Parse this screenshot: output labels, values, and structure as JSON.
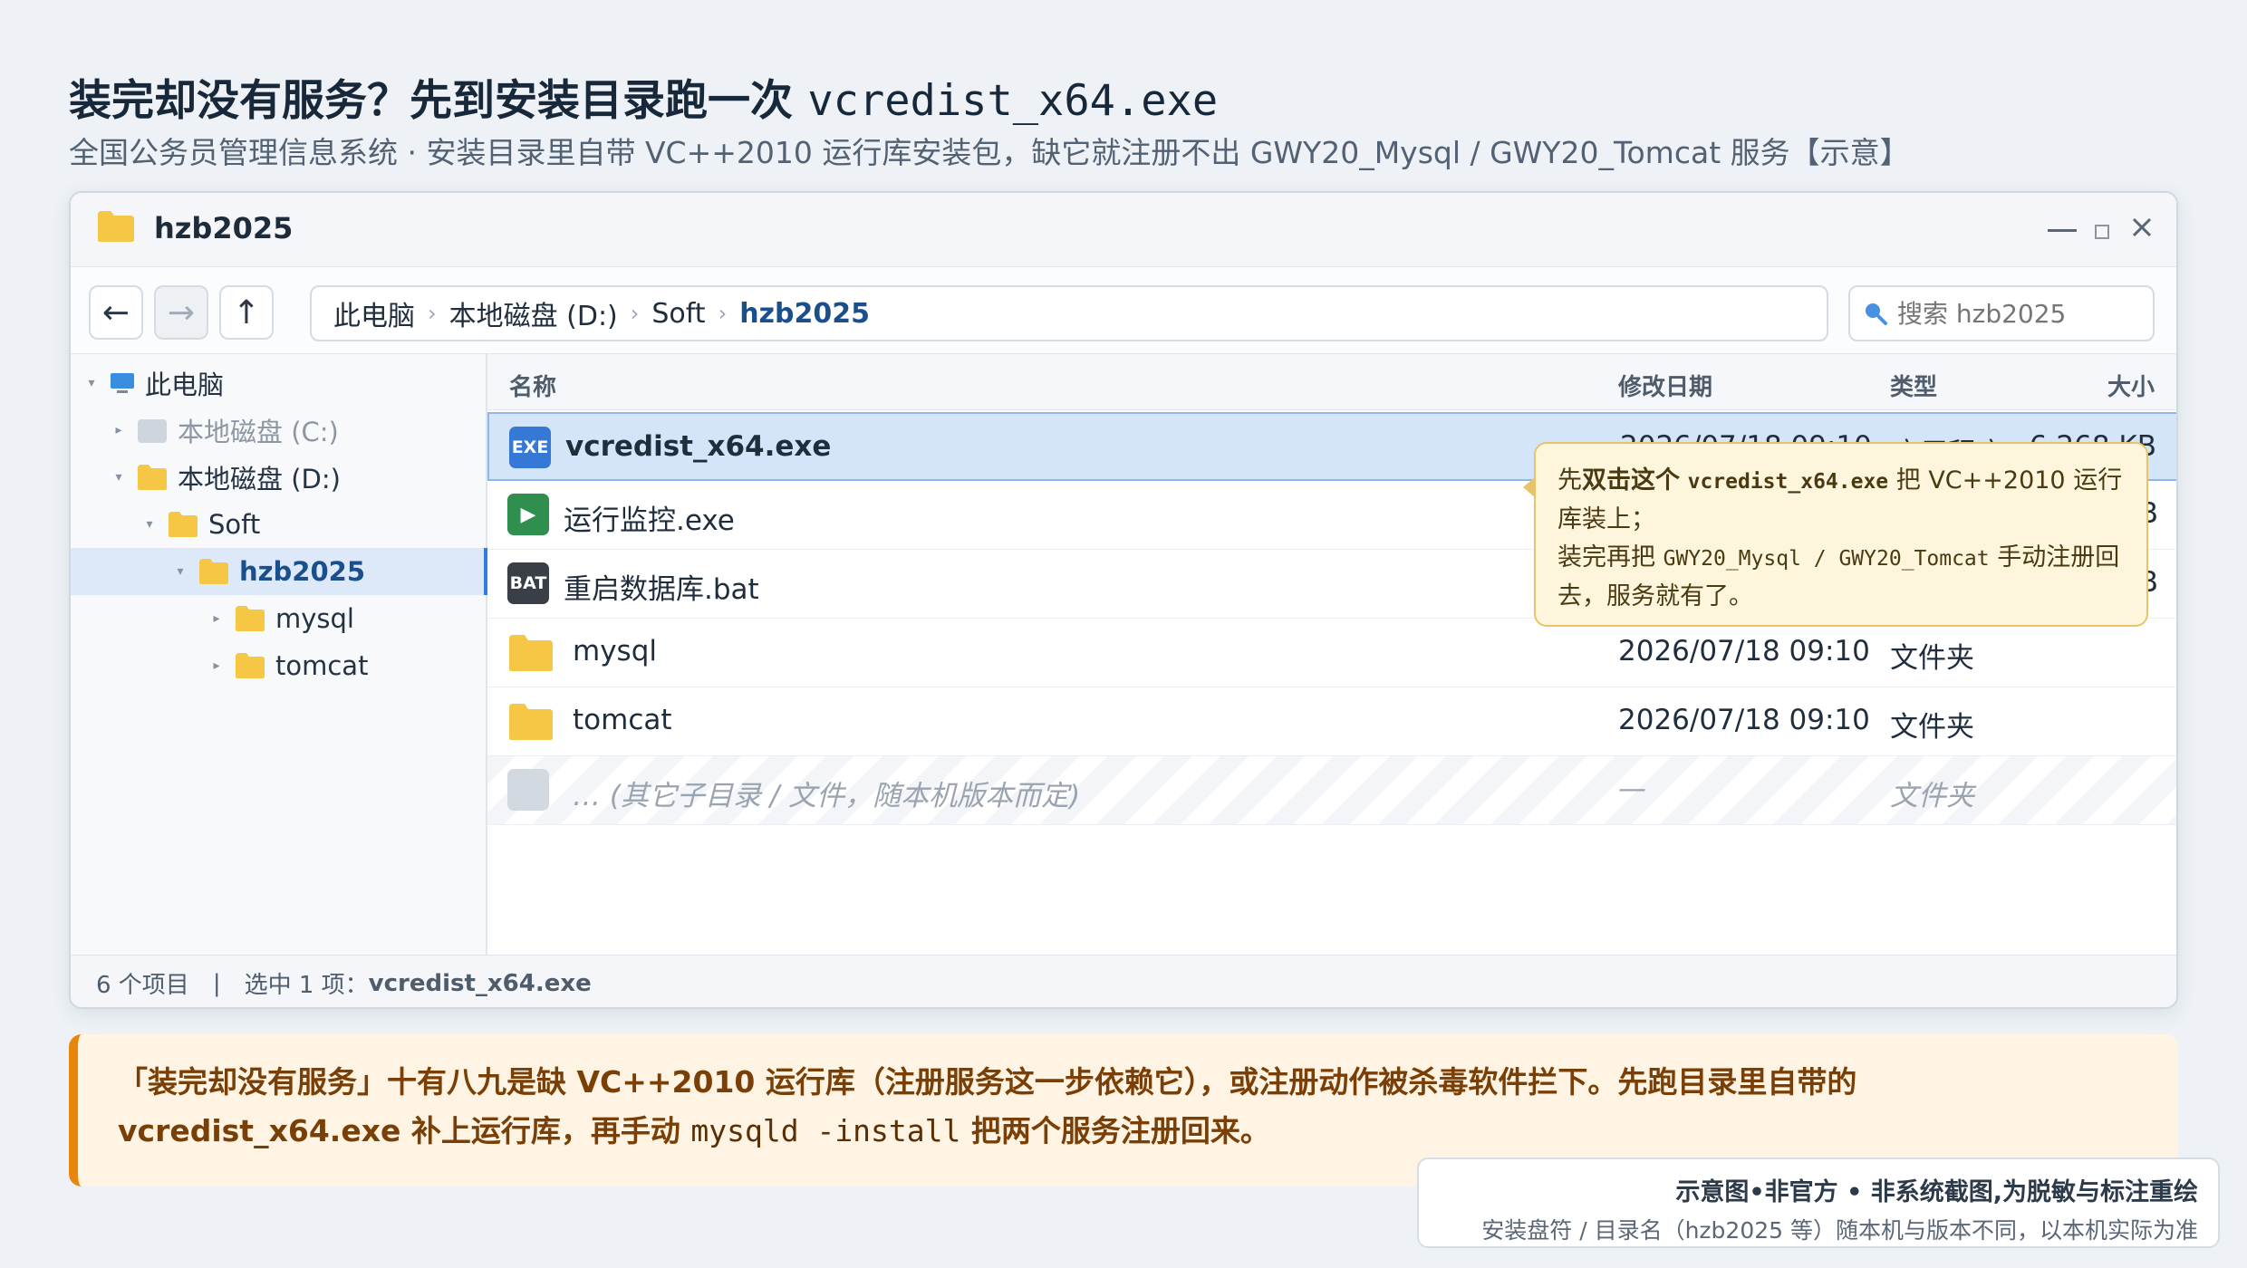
{
  "heading": {
    "title_cn": "装完却没有服务？先到安装目录跑一次",
    "title_code": "vcredist_x64.exe",
    "subtitle": "全国公务员管理信息系统 · 安装目录里自带 VC++2010 运行库安装包，缺它就注册不出 GWY20_Mysql / GWY20_Tomcat 服务【示意】"
  },
  "window": {
    "title": "hzb2025",
    "controls": {
      "minimize": "minimize",
      "maximize": "maximize",
      "close": "close"
    }
  },
  "toolbar": {
    "back_icon": "←",
    "forward_icon": "→",
    "up_icon": "↑",
    "breadcrumb": [
      "此电脑",
      "本地磁盘 (D:)",
      "Soft",
      "hzb2025"
    ],
    "separator": "›",
    "search_placeholder": "搜索 hzb2025"
  },
  "sidebar": {
    "items": [
      {
        "label": "此电脑",
        "icon": "computer-icon",
        "caret": "▾"
      },
      {
        "label": "本地磁盘 (C:)",
        "icon": "drive-icon",
        "caret": "▸"
      },
      {
        "label": "本地磁盘 (D:)",
        "icon": "folder-icon",
        "caret": "▾"
      },
      {
        "label": "Soft",
        "icon": "folder-icon",
        "caret": "▾"
      },
      {
        "label": "hzb2025",
        "icon": "folder-icon",
        "caret": "▾"
      },
      {
        "label": "mysql",
        "icon": "folder-icon",
        "caret": "▸"
      },
      {
        "label": "tomcat",
        "icon": "folder-icon",
        "caret": "▸"
      }
    ]
  },
  "filelist": {
    "columns": {
      "name": "名称",
      "date": "修改日期",
      "type": "类型",
      "size": "大小"
    },
    "rows": [
      {
        "icon_text": "EXE",
        "name": "vcredist_x64.exe",
        "date": "2026/07/18 09:10",
        "type": "应用程序",
        "size": "6,268 KB"
      },
      {
        "icon_text": "▶",
        "name": "运行监控.exe",
        "date": "",
        "type": "",
        "size": "B"
      },
      {
        "icon_text": "BAT",
        "name": "重启数据库.bat",
        "date": "",
        "type": "",
        "size": "B"
      },
      {
        "icon_text": "",
        "name": "mysql",
        "date": "2026/07/18 09:10",
        "type": "文件夹",
        "size": ""
      },
      {
        "icon_text": "",
        "name": "tomcat",
        "date": "2026/07/18 09:10",
        "type": "文件夹",
        "size": ""
      },
      {
        "icon_text": "",
        "name": "… (其它子目录 / 文件，随本机版本而定)",
        "date": "—",
        "type": "文件夹",
        "size": ""
      }
    ]
  },
  "tooltip": {
    "line1_pre": "先",
    "line1_bold": "双击这个",
    "line1_code": "vcredist_x64.exe",
    "line1_post": "把 VC++2010 运行库装上；",
    "line2_pre": "装完再把",
    "line2_code": "GWY20_Mysql / GWY20_Tomcat",
    "line2_post": "手动注册回去，服务就有了。"
  },
  "statusbar": {
    "count": "6 个项目",
    "separator": "|",
    "selected_prefix": "选中 1 项：",
    "selected_name": "vcredist_x64.exe"
  },
  "callout": {
    "line1": "「装完却没有服务」十有八九是缺 VC++2010 运行库（注册服务这一步依赖它），或注册动作被杀毒软件拦下。先跑目录里自带的",
    "line2_pre": "vcredist_x64.exe 补上运行库，再手动",
    "line2_code": "mysqld -install",
    "line2_post": "把两个服务注册回来。"
  },
  "note": {
    "title": "示意图•非官方 • 非系统截图,为脱敏与标注重绘",
    "text": "安装盘符 / 目录名（hzb2025 等）随本机与版本不同，以本机实际为准"
  },
  "colors": {
    "accent_blue": "#2f7de1",
    "selection_bg": "#d5e5f9",
    "folder_yellow": "#f6c744",
    "tooltip_bg": "#fef6dc",
    "callout_accent": "#e8860a"
  }
}
